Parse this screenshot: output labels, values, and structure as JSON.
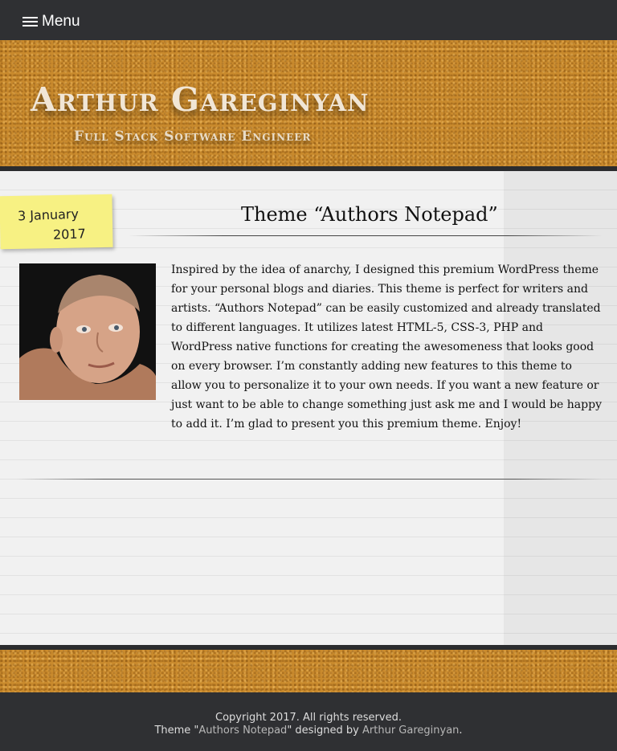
{
  "nav": {
    "menu_label": "Menu"
  },
  "header": {
    "site_title": "Arthur Gareginyan",
    "site_subtitle": "Full Stack Software Engineer"
  },
  "post": {
    "date_day": "3 January",
    "date_year": "2017",
    "title": "Theme “Authors Notepad”",
    "body": "Inspired by the idea of anarchy, I designed this premium WordPress theme for your personal blogs and diaries. This theme is perfect for writers and artists. “Authors Notepad” can be easily customized and already translated to different languages. It utilizes latest HTML-5, CSS-3, PHP and WordPress native functions for creating the awesomeness that looks good on every browser. I’m constantly adding new features to this theme to allow you to personalize it to your own needs. If you want a new feature or just want to be able to change something just ask me and I would be happy to add it. I’m glad to present you this premium theme. Enjoy!"
  },
  "footer": {
    "copyright": "Copyright 2017. All rights reserved.",
    "credit_prefix": "Theme \"",
    "theme_link": "Authors Notepad",
    "credit_middle": "\" designed by ",
    "author_link": "Arthur Gareginyan",
    "credit_suffix": "."
  },
  "colors": {
    "bar": "#2f3033",
    "cork": "#c98a2d",
    "paper": "#f1f1f1",
    "sticky_note": "#f7f183"
  }
}
